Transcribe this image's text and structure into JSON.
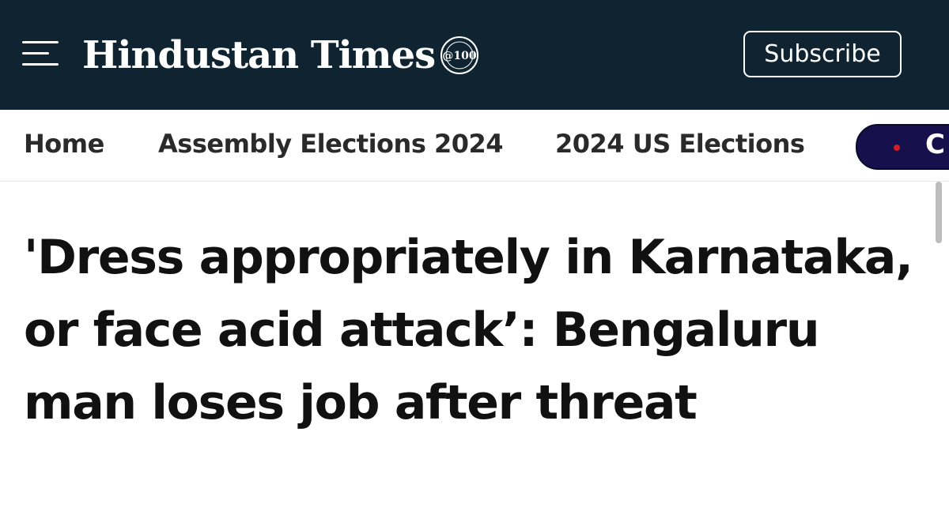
{
  "header": {
    "logo_text": "Hindustan Times",
    "logo_badge": "@100",
    "subscribe_label": "Subscribe",
    "background_color": "#0f2430"
  },
  "nav": {
    "items": [
      {
        "label": "Home"
      },
      {
        "label": "Assembly Elections 2024"
      },
      {
        "label": "2024 US Elections"
      }
    ],
    "pill_label": "C",
    "pill_color": "#16104d"
  },
  "article": {
    "headline": "'Dress appropriately in Karnataka, or face acid attack’: Bengaluru man loses job after threat"
  }
}
